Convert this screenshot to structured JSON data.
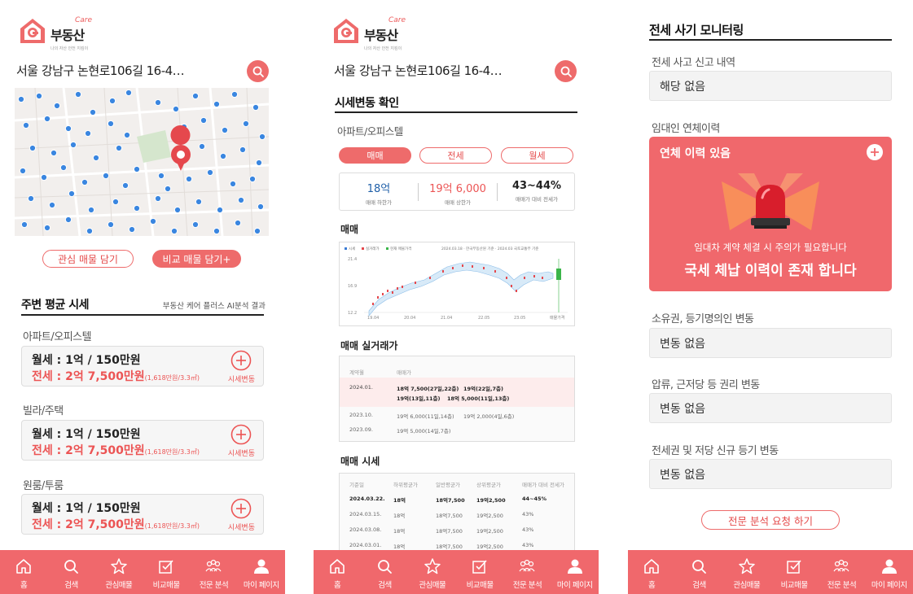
{
  "brand": {
    "name": "부동산",
    "care": "Care",
    "tagline": "나의 자산 안전 지킴이"
  },
  "colors": {
    "accent": "#f0686c",
    "accent_dark": "#e54b4b",
    "price_red": "#ec5454",
    "price_blue": "#1f5fa8"
  },
  "screen1": {
    "address": "서울 강남구 논현로106길 16-4…",
    "buttons": {
      "interest": "관심 매물 담기",
      "compare": "비교 매물 담기+"
    },
    "section_title": "주변 평균 시세",
    "section_note": "부동산 케어 플러스 AI분석 결과",
    "groups": [
      {
        "label": "아파트/오피스텔",
        "monthly": "월세 : 1억 / 150만원",
        "jeonse": "전세 : 2억 7,500만원",
        "per_area": "(1,618만원/3.3㎡)",
        "action": "시세변동"
      },
      {
        "label": "빌라/주택",
        "monthly": "월세 : 1억 / 150만원",
        "jeonse": "전세 : 2억 7,500만원",
        "per_area": "(1,618만원/3.3㎡)",
        "action": "시세변동"
      },
      {
        "label": "원룸/투룸",
        "monthly": "월세 : 1억 / 150만원",
        "jeonse": "전세 : 2억 7,500만원",
        "per_area": "(1,618만원/3.3㎡)",
        "action": "시세변동"
      }
    ]
  },
  "screen2": {
    "address": "서울 강남구 논현로106길 16-4…",
    "title": "시세변동 확인",
    "category": "아파트/오피스텔",
    "tabs": [
      "매매",
      "전세",
      "월세"
    ],
    "stats": [
      {
        "value": "18억",
        "caption": "매매 하한가"
      },
      {
        "value": "19억 6,000",
        "caption": "매매 상한가"
      },
      {
        "value": "43~44%",
        "caption": "매매가 대비 전세가"
      }
    ],
    "chart_title": "매매",
    "chart": {
      "legend": [
        "시세",
        "실거래가",
        "현재 매물가격"
      ],
      "source": "2024.03.18 · 한국부동산원 기준 · 2024.03 국토교통부 기준",
      "y_ticks": [
        "21.4",
        "16.9",
        "12.2"
      ],
      "x_ticks": [
        "19.04",
        "20.04",
        "21.04",
        "22.05",
        "23.05",
        "매물가격"
      ]
    },
    "deals_title": "매매 실거래가",
    "deals": {
      "headers": [
        "계약월",
        "매매가"
      ],
      "rows": [
        {
          "month": "2024.01.",
          "line1a": "18억 7,500(27일,22층)",
          "line1b": "19억(22일,7층)",
          "line2a": "19억(13일,11층)",
          "line2b": "18억 5,000(11일,13층)"
        },
        {
          "month": "2023.10.",
          "line1a": "19억 6,000(11일,14층)",
          "line1b": "19억 2,000(4일,6층)"
        },
        {
          "month": "2023.09.",
          "line1a": "19억 5,000(14일,7층)"
        }
      ]
    },
    "market_title": "매매 시세",
    "market": {
      "headers": [
        "기준일",
        "하위평균가",
        "일반평균가",
        "상위평균가",
        "매매가 대비 전세가"
      ],
      "rows": [
        [
          "2024.03.22.",
          "18억",
          "18억7,500",
          "19억2,500",
          "44~45%"
        ],
        [
          "2024.03.15.",
          "18억",
          "18억7,500",
          "19억2,500",
          "43%"
        ],
        [
          "2024.03.08.",
          "18억",
          "18억7,500",
          "19억2,500",
          "43%"
        ],
        [
          "2024.03.01.",
          "18억",
          "18억7,500",
          "19억2,500",
          "43%"
        ]
      ]
    }
  },
  "screen3": {
    "title": "전세 사기 모니터링",
    "fields": [
      {
        "label": "전세 사고 신고 내역",
        "value": "해당 없음"
      },
      {
        "label": "소유권, 등기명의인 변동",
        "value": "변동 없음"
      },
      {
        "label": "압류, 근저당 등 권리 변동",
        "value": "변동 없음"
      },
      {
        "label": "전세권 및 저당 신규 등기 변동",
        "value": "변동 없음"
      }
    ],
    "arrears": {
      "label": "임대인 연체이력",
      "card_title": "연체 이력 있음",
      "warning": "임대차 계약 체결 시 주의가 필요합니다",
      "headline": "국세 체납 이력이 존재 합니다"
    },
    "request_button": "전문 분석 요청 하기"
  },
  "nav": [
    "홈",
    "검색",
    "관심매물",
    "비교매물",
    "전문 분석",
    "마이 페이지"
  ]
}
